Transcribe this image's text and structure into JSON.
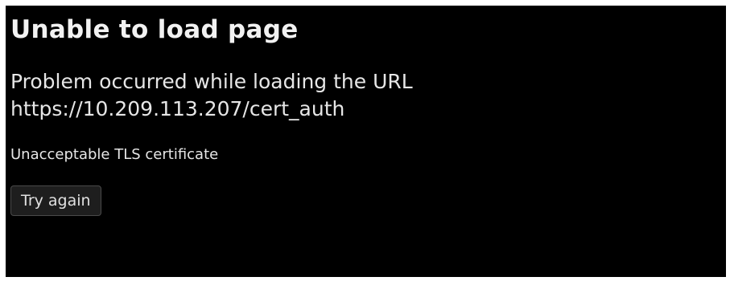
{
  "error_page": {
    "title": "Unable to load page",
    "message_line1": "Problem occurred while loading the URL",
    "url": "https://10.209.113.207/cert_auth",
    "reason": "Unacceptable TLS certificate",
    "retry_label": "Try again"
  },
  "colors": {
    "background": "#000000",
    "text": "#e6e6e6",
    "button_background": "#1e1e1e",
    "button_border": "#4a4a4a"
  }
}
